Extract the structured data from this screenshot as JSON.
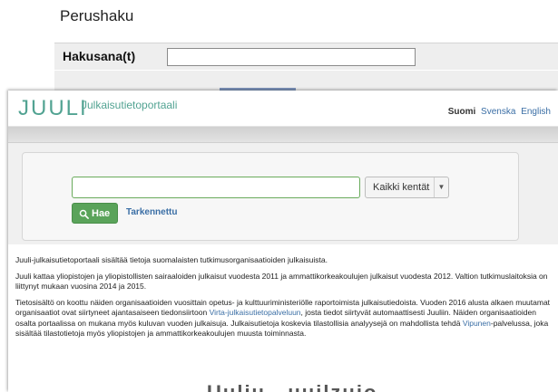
{
  "back": {
    "title": "Perushaku",
    "field_label": "Hakusana(t)",
    "field_value": ""
  },
  "header": {
    "logo": "JUULI",
    "subtitle": "Julkaisutietoportaali",
    "languages": {
      "current": "Suomi",
      "links": [
        "Svenska",
        "English"
      ]
    }
  },
  "search": {
    "query": "",
    "field_select": "Kaikki kentät",
    "search_button": "Hae",
    "search_icon": "search-icon",
    "advanced_link": "Tarkennettu"
  },
  "content": {
    "p1": "Juuli-julkaisutietoportaali sisältää tietoja suomalaisten tutkimusorganisaatioiden julkaisuista.",
    "p2": "Juuli kattaa yliopistojen ja yliopistollisten sairaaloiden julkaisut vuodesta 2011 ja ammattikorkeakoulujen julkaisut vuodesta 2012. Valtion tutkimuslaitoksia on liittynyt mukaan vuosina 2014 ja 2015.",
    "p3": {
      "part1": "Tietosisältö on koottu näiden organisaatioiden vuosittain opetus- ja kulttuuriministeriölle raportoimista julkaisutiedoista. Vuoden 2016 alusta alkaen muutamat organisaatiot ovat siirtyneet ajantasaiseen tiedonsiirtoon ",
      "link1": "Virta-julkaisutietopalveluun",
      "part2": ", josta tiedot siirtyvät automaattisesti Juuliin. Näiden organisaatioiden osalta portaalissa on mukana myös kuluvan vuoden julkaisuja. Julkaisutietoja koskevia tilastollisia analyysejä on mahdollista tehdä ",
      "link2": "Vipunen",
      "part3": "-palvelussa, joka sisältää tilastotietoja myös yliopistojen ja ammattikorkeakoulujen muusta toiminnasta."
    }
  },
  "watermark": "Uuliu ‚ uuilzuio",
  "colors": {
    "brand": "#52a392",
    "button": "#5aa35a",
    "link": "#3a6ea5"
  }
}
